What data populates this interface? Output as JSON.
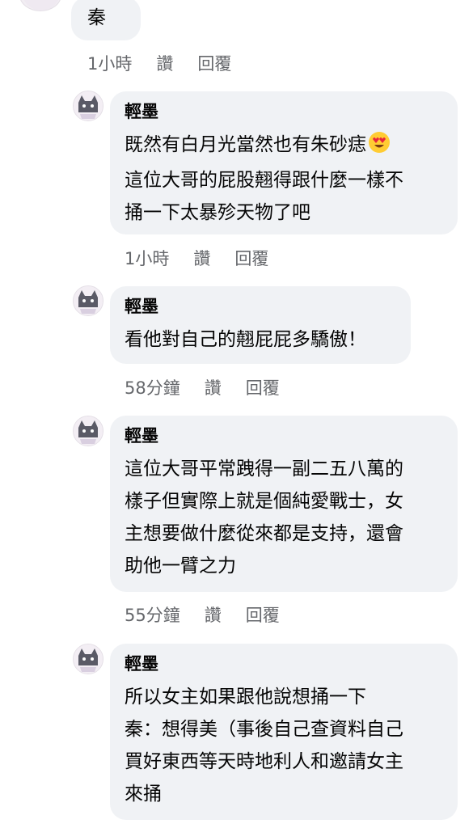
{
  "top_comment": {
    "text": "秦",
    "time": "1小時",
    "like": "讚",
    "reply": "回覆"
  },
  "comments": [
    {
      "author": "輕墨",
      "lines": [
        "既然有白月光當然也有朱砂痣",
        "這位大哥的屁股翹得跟什麼一樣不",
        "捅一下太暴殄天物了吧"
      ],
      "emoji": "heart-eyes-emoji",
      "time": "1小時",
      "like": "讚",
      "reply": "回覆"
    },
    {
      "author": "輕墨",
      "lines": [
        "看他對自己的翹屁屁多驕傲！"
      ],
      "time": "58分鐘",
      "like": "讚",
      "reply": "回覆"
    },
    {
      "author": "輕墨",
      "lines": [
        "這位大哥平常跩得一副二五八萬的",
        "樣子但實際上就是個純愛戰士，女",
        "主想要做什麼從來都是支持，還會",
        "助他一臂之力"
      ],
      "time": "55分鐘",
      "like": "讚",
      "reply": "回覆"
    },
    {
      "author": "輕墨",
      "lines": [
        "所以女主如果跟他說想捅一下",
        "秦：想得美（事後自己查資料自己",
        "買好東西等天時地利人和邀請女主",
        "來捅"
      ]
    }
  ],
  "colors": {
    "bubble": "#f0f2f5",
    "meta": "#65676b",
    "text": "#050505"
  }
}
